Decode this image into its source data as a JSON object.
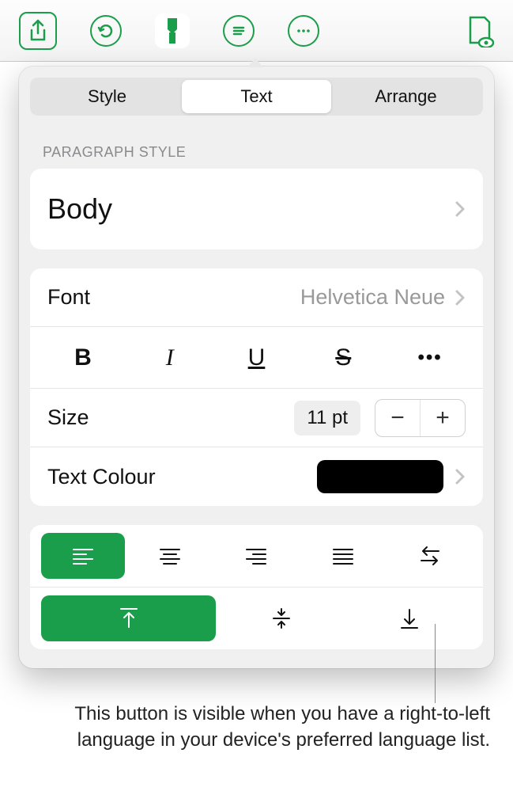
{
  "toolbar": {
    "share": "share",
    "undo": "undo",
    "format": "format",
    "list": "list",
    "more": "more",
    "view": "view"
  },
  "tabs": {
    "style": "Style",
    "text": "Text",
    "arrange": "Arrange"
  },
  "paragraph_style_label": "PARAGRAPH STYLE",
  "paragraph_style_value": "Body",
  "font": {
    "label": "Font",
    "value": "Helvetica Neue",
    "bold": "B",
    "italic": "I",
    "underline": "U",
    "strike": "S",
    "more": "•••"
  },
  "size": {
    "label": "Size",
    "value": "11 pt",
    "minus": "−",
    "plus": "+"
  },
  "text_colour": {
    "label": "Text Colour",
    "value_hex": "#000000"
  },
  "callout": "This button is visible when you have a right-to-left language in your device's preferred language list."
}
